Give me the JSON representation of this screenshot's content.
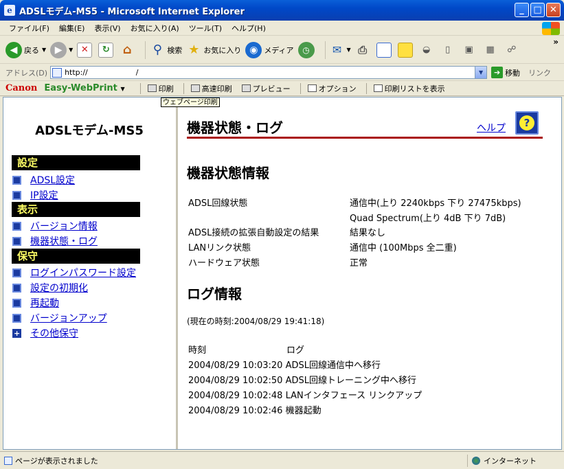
{
  "window": {
    "title": "ADSLモデム-MS5 - Microsoft Internet Explorer",
    "minimize": "_",
    "maximize": "□",
    "close": "✕"
  },
  "menu": [
    "ファイル(F)",
    "編集(E)",
    "表示(V)",
    "お気に入り(A)",
    "ツール(T)",
    "ヘルプ(H)"
  ],
  "toolbar": {
    "back": "戻る",
    "search": "検索",
    "favorites": "お気に入り",
    "media": "メディア",
    "more": "»"
  },
  "address": {
    "label": "アドレス(D)",
    "url": "http://                    /",
    "go": "移動",
    "links": "リンク"
  },
  "canon": {
    "brand": "Canon",
    "product": "Easy-WebPrint",
    "print": "印刷",
    "fast_print": "高速印刷",
    "preview": "プレビュー",
    "options": "オプション",
    "print_list": "印刷リストを表示",
    "tooltip": "ウェブページ印刷"
  },
  "sidebar": {
    "device": "ADSLモデム-MS5",
    "sections": [
      {
        "label": "設定",
        "items": [
          "ADSL設定",
          "IP設定"
        ]
      },
      {
        "label": "表示",
        "items": [
          "バージョン情報",
          "機器状態・ログ"
        ]
      },
      {
        "label": "保守",
        "items": [
          "ログインパスワード設定",
          "設定の初期化",
          "再起動",
          "バージョンアップ",
          "その他保守"
        ]
      }
    ]
  },
  "main": {
    "title": "機器状態・ログ",
    "help": "ヘルプ",
    "help_icon": "?",
    "status_heading": "機器状態情報",
    "status_rows": [
      {
        "label": "ADSL回線状態",
        "value": "通信中(上り 2240kbps 下り 27475kbps)"
      },
      {
        "label": "",
        "value": "Quad Spectrum(上り 4dB 下り 7dB)"
      },
      {
        "label": "ADSL接続の拡張自動設定の結果",
        "value": "結果なし"
      },
      {
        "label": "LANリンク状態",
        "value": "通信中 (100Mbps 全二重)"
      },
      {
        "label": "ハードウェア状態",
        "value": "正常"
      }
    ],
    "log_heading": "ログ情報",
    "current_time": "(現在の時刻:2004/08/29 19:41:18)",
    "log_col_time": "時刻",
    "log_col_log": "ログ",
    "logs": [
      {
        "time": "2004/08/29 10:03:20",
        "msg": "ADSL回線通信中へ移行"
      },
      {
        "time": "2004/08/29 10:02:50",
        "msg": "ADSL回線トレーニング中へ移行"
      },
      {
        "time": "2004/08/29 10:02:48",
        "msg": "LANインタフェース リンクアップ"
      },
      {
        "time": "2004/08/29 10:02:46",
        "msg": "機器起動"
      }
    ]
  },
  "statusbar": {
    "left": "ページが表示されました",
    "zone": "インターネット"
  }
}
